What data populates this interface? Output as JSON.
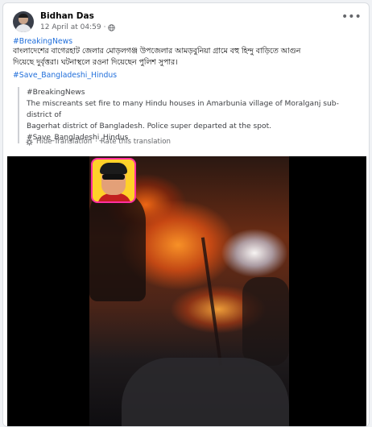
{
  "post": {
    "author": "Bidhan Das",
    "date": "12 April at 04:59",
    "separator": "·",
    "more_icon": "more-options-icon",
    "privacy_icon": "globe-icon"
  },
  "content": {
    "hashtag_breaking": "#BreakingNews",
    "bangla_line1": "বাংলাদেশের বাগেরহাট জেলার মোড়লগঞ্জ উপজেলার আমড়বুনিয়া গ্রামে বহু হিন্দু বাড়িতে আগুন",
    "bangla_line2": "দিয়েছে দুর্বৃত্তরা। ঘটনাস্থলে রওনা দিয়েছেন পুলিশ সুপার।",
    "hashtag_save": "#Save_Bangladeshi_Hindus"
  },
  "translation": {
    "hashtag_breaking": "#BreakingNews",
    "line1": "The miscreants set fire to many Hindu houses in Amarbunia village of Moralganj sub-district of",
    "line2": "Bagerhat district of Bangladesh. Police super departed at the spot.",
    "hashtag_save": "#Save_Bangladeshi_Hindus",
    "hide_label": "Hide Translation",
    "separator": "·",
    "rate_label": "Rate this translation"
  },
  "video": {
    "description_icon": "channel-logo-icon"
  }
}
